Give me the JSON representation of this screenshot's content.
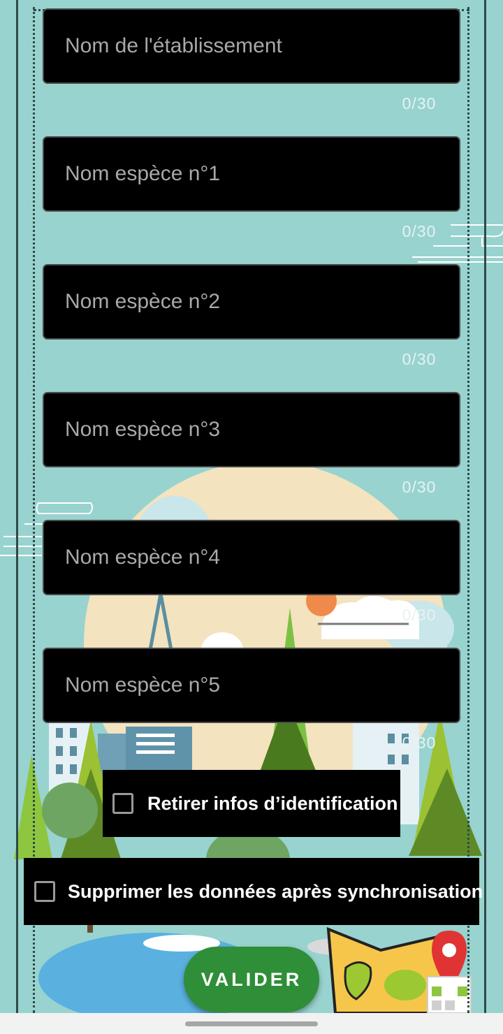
{
  "form": {
    "fields": [
      {
        "placeholder": "Nom de l'établissement",
        "value": "",
        "counter": "0/30"
      },
      {
        "placeholder": "Nom espèce n°1",
        "value": "",
        "counter": "0/30"
      },
      {
        "placeholder": "Nom espèce n°2",
        "value": "",
        "counter": "0/30"
      },
      {
        "placeholder": "Nom espèce n°3",
        "value": "",
        "counter": "0/30"
      },
      {
        "placeholder": "Nom espèce n°4",
        "value": "",
        "counter": "0/30"
      },
      {
        "placeholder": "Nom espèce n°5",
        "value": "",
        "counter": "0/30"
      }
    ],
    "checkboxes": [
      {
        "label": "Retirer infos d’identification",
        "checked": false
      },
      {
        "label": "Supprimer les données après synchronisation",
        "checked": false
      }
    ],
    "submit_label": "VALIDER"
  },
  "colors": {
    "background": "#98d3cf",
    "field_background": "#000000",
    "button": "#2f8e38",
    "placeholder": "#a9a9a9"
  },
  "background_illustration": [
    "map-icon",
    "location-pin-icon",
    "cloud-icon",
    "tree-icon",
    "building-icon",
    "lake-icon",
    "sun-icon"
  ]
}
